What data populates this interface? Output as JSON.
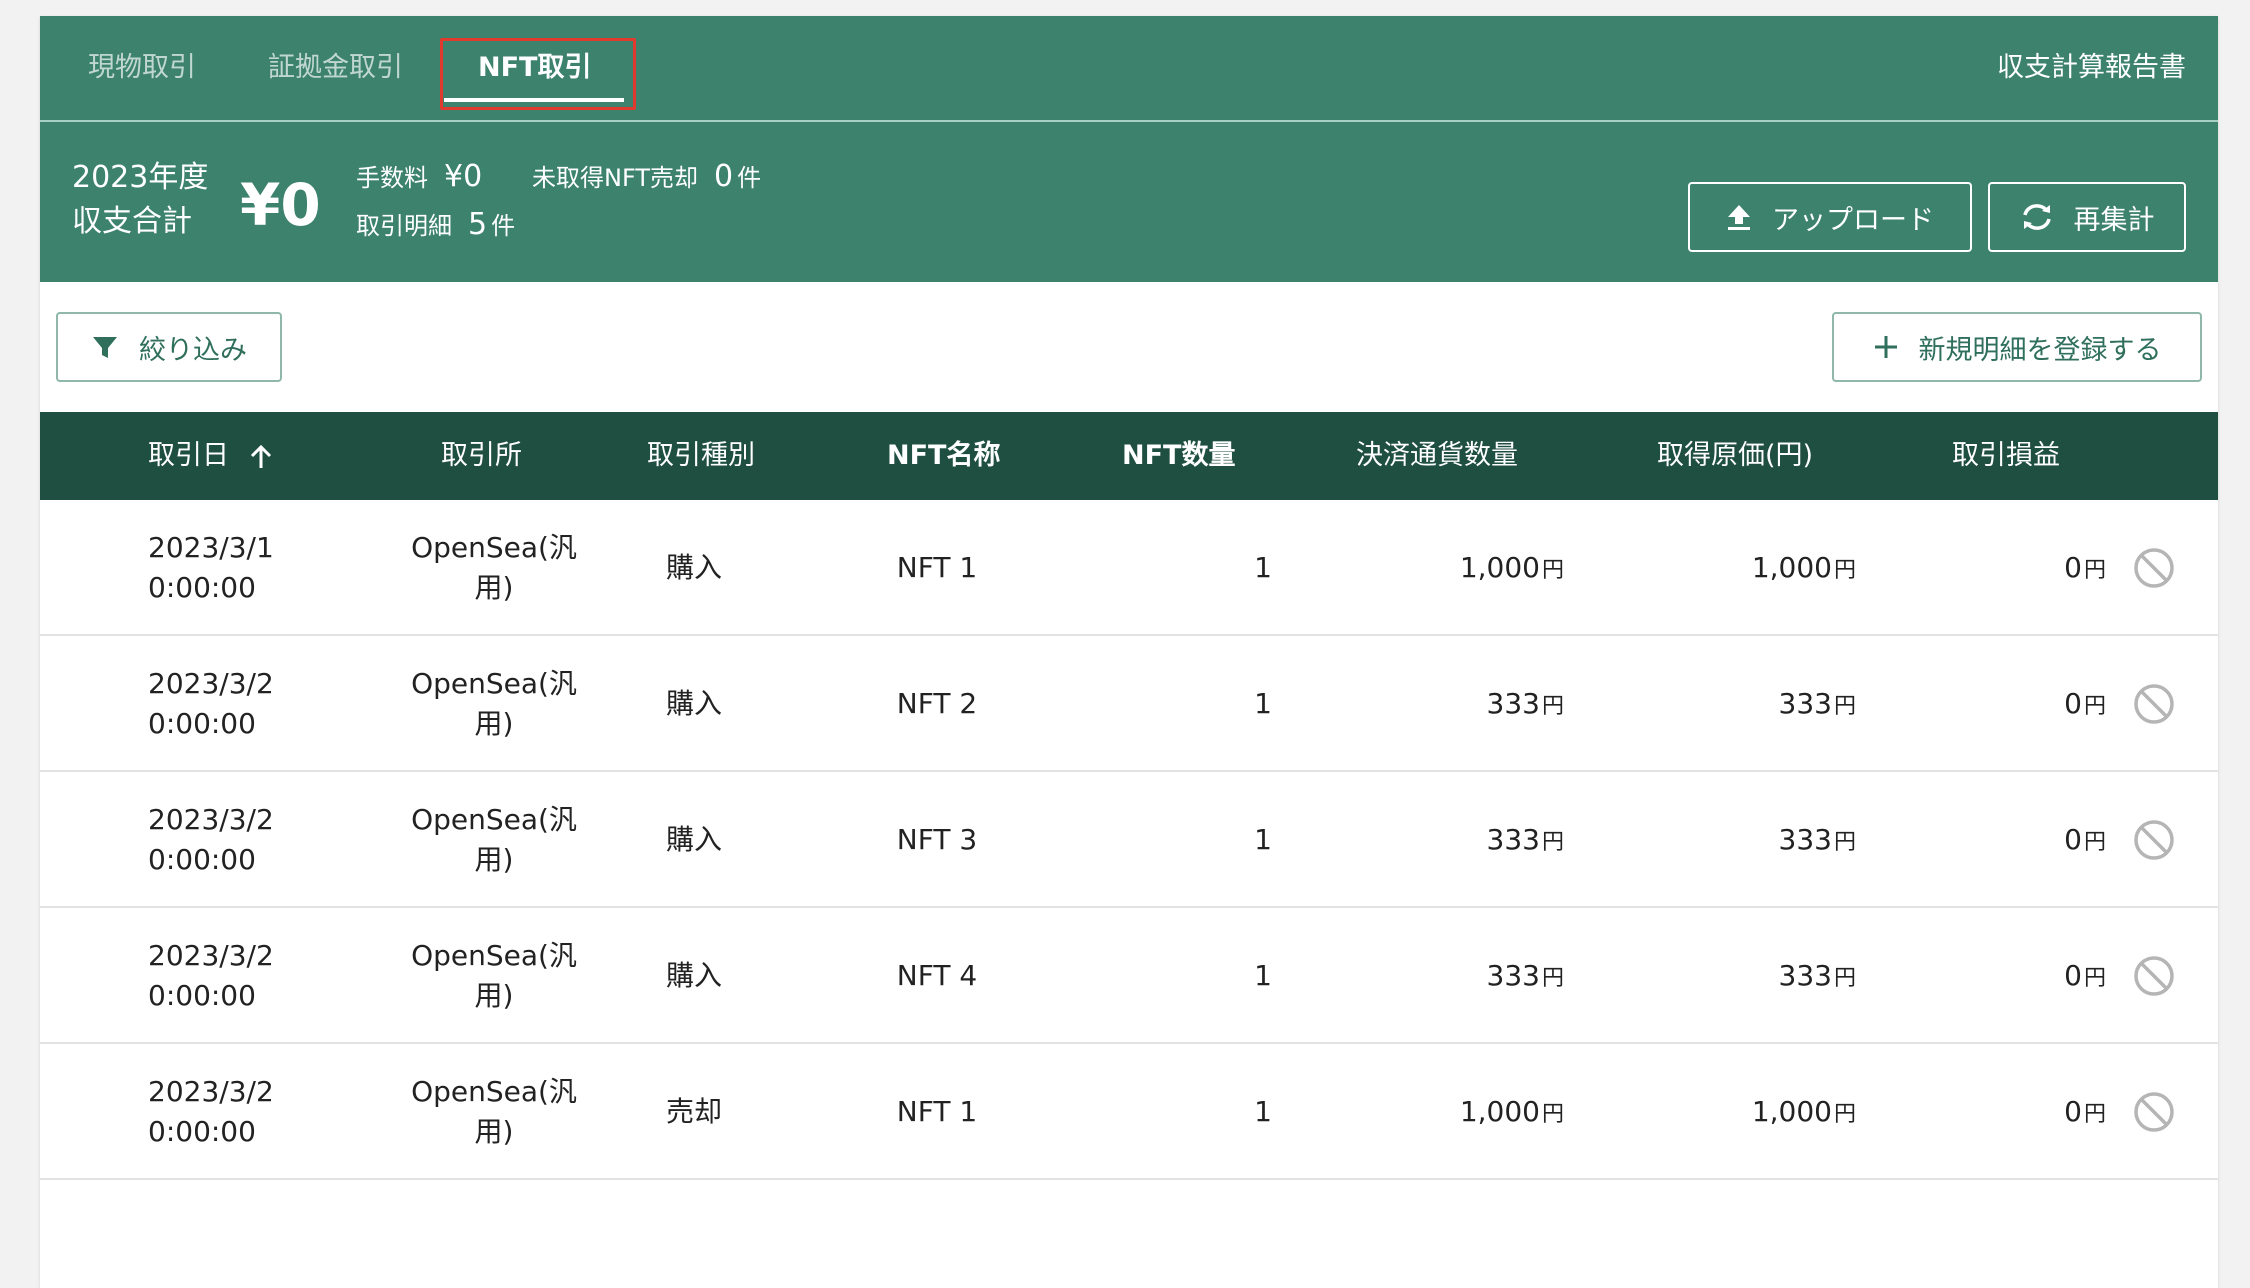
{
  "tabs": [
    {
      "label": "現物取引"
    },
    {
      "label": "証拠金取引"
    },
    {
      "label": "NFT取引"
    }
  ],
  "report_link": "収支計算報告書",
  "summary": {
    "year_line1": "2023年度",
    "year_line2": "収支合計",
    "total": "¥0",
    "fee_label": "手数料",
    "fee_value": "¥0",
    "unacquired_label": "未取得NFT売却",
    "unacquired_value": "0",
    "unacquired_unit": "件",
    "details_label": "取引明細",
    "details_value": "5",
    "details_unit": "件",
    "upload_label": "アップロード",
    "recalc_label": "再集計"
  },
  "actions": {
    "filter_label": "絞り込み",
    "new_label": "新規明細を登録する"
  },
  "table": {
    "headers": {
      "date": "取引日",
      "exchange": "取引所",
      "type": "取引種別",
      "nft_name": "NFT名称",
      "nft_qty": "NFT数量",
      "settle_qty": "決済通貨数量",
      "cost": "取得原価(円)",
      "pnl": "取引損益"
    },
    "yen_unit": "円",
    "rows": [
      {
        "date1": "2023/3/1",
        "date2": "0:00:00",
        "ex1": "OpenSea(汎",
        "ex2": "用)",
        "type": "購入",
        "name": "NFT 1",
        "qty": "1",
        "settle": "1,000",
        "cost": "1,000",
        "pnl": "0"
      },
      {
        "date1": "2023/3/2",
        "date2": "0:00:00",
        "ex1": "OpenSea(汎",
        "ex2": "用)",
        "type": "購入",
        "name": "NFT 2",
        "qty": "1",
        "settle": "333",
        "cost": "333",
        "pnl": "0"
      },
      {
        "date1": "2023/3/2",
        "date2": "0:00:00",
        "ex1": "OpenSea(汎",
        "ex2": "用)",
        "type": "購入",
        "name": "NFT 3",
        "qty": "1",
        "settle": "333",
        "cost": "333",
        "pnl": "0"
      },
      {
        "date1": "2023/3/2",
        "date2": "0:00:00",
        "ex1": "OpenSea(汎",
        "ex2": "用)",
        "type": "購入",
        "name": "NFT 4",
        "qty": "1",
        "settle": "333",
        "cost": "333",
        "pnl": "0"
      },
      {
        "date1": "2023/3/2",
        "date2": "0:00:00",
        "ex1": "OpenSea(汎",
        "ex2": "用)",
        "type": "売却",
        "name": "NFT 1",
        "qty": "1",
        "settle": "1,000",
        "cost": "1,000",
        "pnl": "0"
      }
    ]
  },
  "colors": {
    "header_green": "#3d826d",
    "table_header": "#1f4f41",
    "highlight_red": "#e03a2f"
  }
}
